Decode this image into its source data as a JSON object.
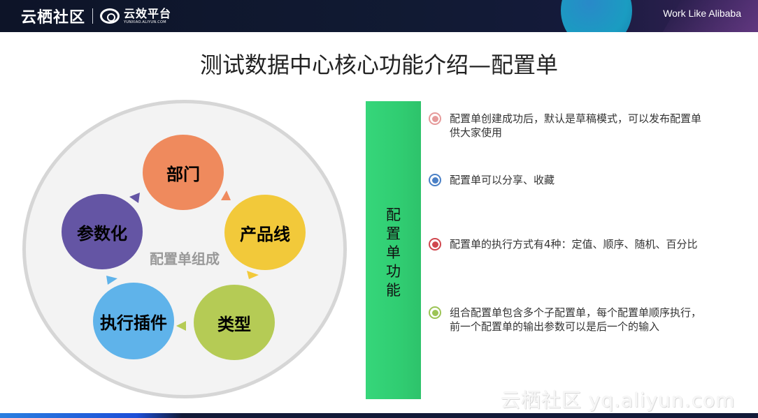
{
  "header": {
    "brand_primary": "云栖社区",
    "brand_secondary": "云效平台",
    "brand_secondary_url": "YUNXIAO.ALIYUN.COM",
    "slogan": "Work Like Alibaba"
  },
  "title": "测试数据中心核心功能介绍—配置单",
  "diagram": {
    "center_label": "配置单组成",
    "nodes": [
      {
        "label": "部门",
        "color": "#ef8a5d"
      },
      {
        "label": "产品线",
        "color": "#f2c93a"
      },
      {
        "label": "类型",
        "color": "#b5cb55"
      },
      {
        "label": "执行插件",
        "color": "#5fb3ea"
      },
      {
        "label": "参数化",
        "color": "#6455a4"
      }
    ]
  },
  "side_bar": {
    "label_chars": [
      "配",
      "置",
      "单",
      "功",
      "能"
    ],
    "color": "#33d176"
  },
  "features": [
    {
      "text_line1": "配置单创建成功后，默认是草稿模式，可以发布配置单",
      "text_line2": "供大家使用",
      "bullet_color": "#e69a9a"
    },
    {
      "text_line1": "配置单可以分享、收藏",
      "text_line2": "",
      "bullet_color": "#4a80c6"
    },
    {
      "text_line1": "配置单的执行方式有4种：定值、顺序、随机、百分比",
      "text_line2": "",
      "bullet_color": "#d0474e"
    },
    {
      "text_line1": "组合配置单包含多个子配置单，每个配置单顺序执行，",
      "text_line2": "前一个配置单的输出参数可以是后一个的输入",
      "bullet_color": "#9cc455"
    }
  ],
  "watermark": "云栖社区 yq.aliyun.com"
}
